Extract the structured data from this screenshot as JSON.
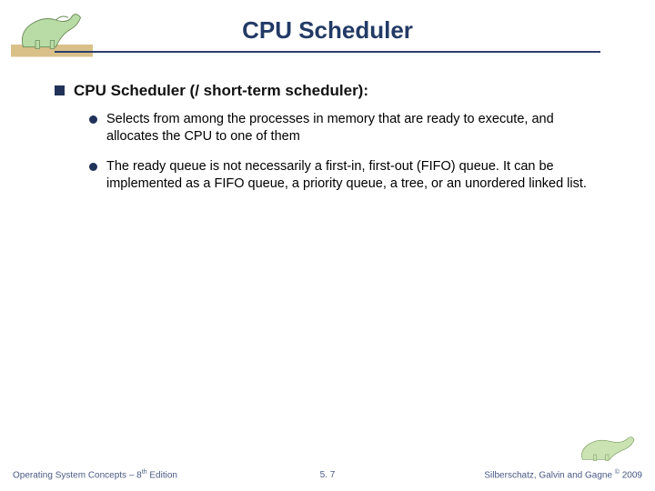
{
  "title": "CPU Scheduler",
  "bullets": {
    "level1": "CPU Scheduler (/ short-term scheduler):",
    "level2": [
      "Selects from among the processes in memory that are ready to execute, and allocates the CPU to one of them",
      "The ready queue is not necessarily a first-in, first-out (FIFO) queue. It can be implemented as a FIFO queue, a priority queue, a tree, or an unordered linked list."
    ]
  },
  "footer": {
    "left_prefix": "Operating System Concepts – 8",
    "left_sup": "th",
    "left_suffix": " Edition",
    "center": "5. 7",
    "right_prefix": "Silberschatz, Galvin and Gagne ",
    "right_sup": "©",
    "right_suffix": " 2009"
  },
  "logo": {
    "name_tl": "dinosaur-logo",
    "name_br": "dinosaur-logo-small"
  }
}
